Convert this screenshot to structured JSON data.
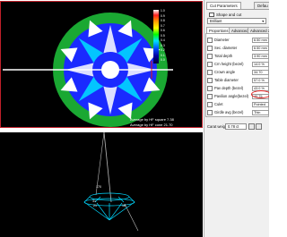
{
  "viewer": {
    "avg_square_label": "Average by HF square  7.38",
    "avg_cone_label": "Average by HF cone   21.70",
    "color_scale": [
      "1.0",
      "0.9",
      "0.8",
      "0.7",
      "0.6",
      "0.5",
      "0.4",
      "0.3",
      "0.2",
      "0.1",
      "0.0"
    ],
    "colors": {
      "green": "#1aa832",
      "blue": "#1a2aff",
      "cyan": "#00e0ff",
      "white": "#ffffff",
      "red": "#e01010",
      "border": "#c0202a"
    }
  },
  "bottom": {
    "angle_labels": [
      "170",
      "31",
      "21",
      "18"
    ]
  },
  "panel": {
    "tabs": [
      "Cut Parameters",
      "Defau"
    ],
    "shape_label": "Shape and cut",
    "shape_value": "Brilliant",
    "subtabs": [
      "Proportions",
      "Advanced",
      "Advanced 2"
    ],
    "params": [
      {
        "label": "Diameter",
        "value": "6.50 mm"
      },
      {
        "label": "Sec. diameter",
        "value": "6.50 mm"
      },
      {
        "label": "Total depth",
        "value": "3.90 mm"
      },
      {
        "label": "Crn height (bezel)",
        "value": "14.0 %"
      },
      {
        "label": "Crown angle",
        "value": "34.70"
      },
      {
        "label": "Table diameter",
        "value": "57.0 %"
      },
      {
        "label": "Pav depth (bezel)",
        "value": "43.0 %"
      },
      {
        "label": "Pavilion angle(bezel)",
        "value": "40.75"
      },
      {
        "label": "Culet",
        "value": "Pointed"
      },
      {
        "label": "Girdle avg (bezel)",
        "value": "Thin"
      }
    ],
    "carat_label": "Carat weight",
    "carat_value": "0.78 ct"
  }
}
